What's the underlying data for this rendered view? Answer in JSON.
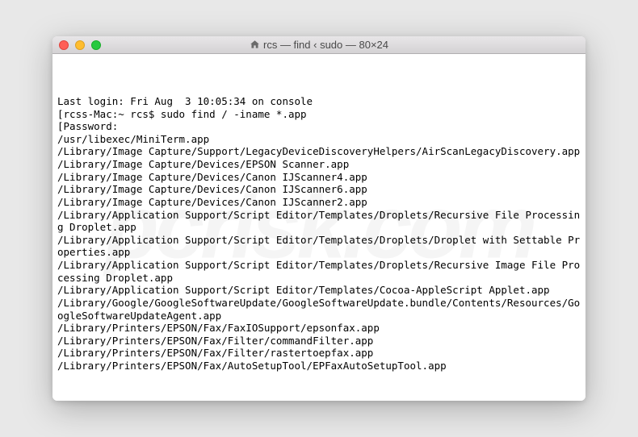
{
  "titlebar": {
    "title": "rcs — find ‹ sudo — 80×24"
  },
  "terminal": {
    "lines": [
      "Last login: Fri Aug  3 10:05:34 on console",
      "[rcss-Mac:~ rcs$ sudo find / -iname *.app",
      "[Password:",
      "/usr/libexec/MiniTerm.app",
      "/Library/Image Capture/Support/LegacyDeviceDiscoveryHelpers/AirScanLegacyDiscovery.app",
      "/Library/Image Capture/Devices/EPSON Scanner.app",
      "/Library/Image Capture/Devices/Canon IJScanner4.app",
      "/Library/Image Capture/Devices/Canon IJScanner6.app",
      "/Library/Image Capture/Devices/Canon IJScanner2.app",
      "/Library/Application Support/Script Editor/Templates/Droplets/Recursive File Processing Droplet.app",
      "/Library/Application Support/Script Editor/Templates/Droplets/Droplet with Settable Properties.app",
      "/Library/Application Support/Script Editor/Templates/Droplets/Recursive Image File Processing Droplet.app",
      "/Library/Application Support/Script Editor/Templates/Cocoa-AppleScript Applet.app",
      "/Library/Google/GoogleSoftwareUpdate/GoogleSoftwareUpdate.bundle/Contents/Resources/GoogleSoftwareUpdateAgent.app",
      "/Library/Printers/EPSON/Fax/FaxIOSupport/epsonfax.app",
      "/Library/Printers/EPSON/Fax/Filter/commandFilter.app",
      "/Library/Printers/EPSON/Fax/Filter/rastertoepfax.app",
      "/Library/Printers/EPSON/Fax/AutoSetupTool/EPFaxAutoSetupTool.app"
    ]
  }
}
